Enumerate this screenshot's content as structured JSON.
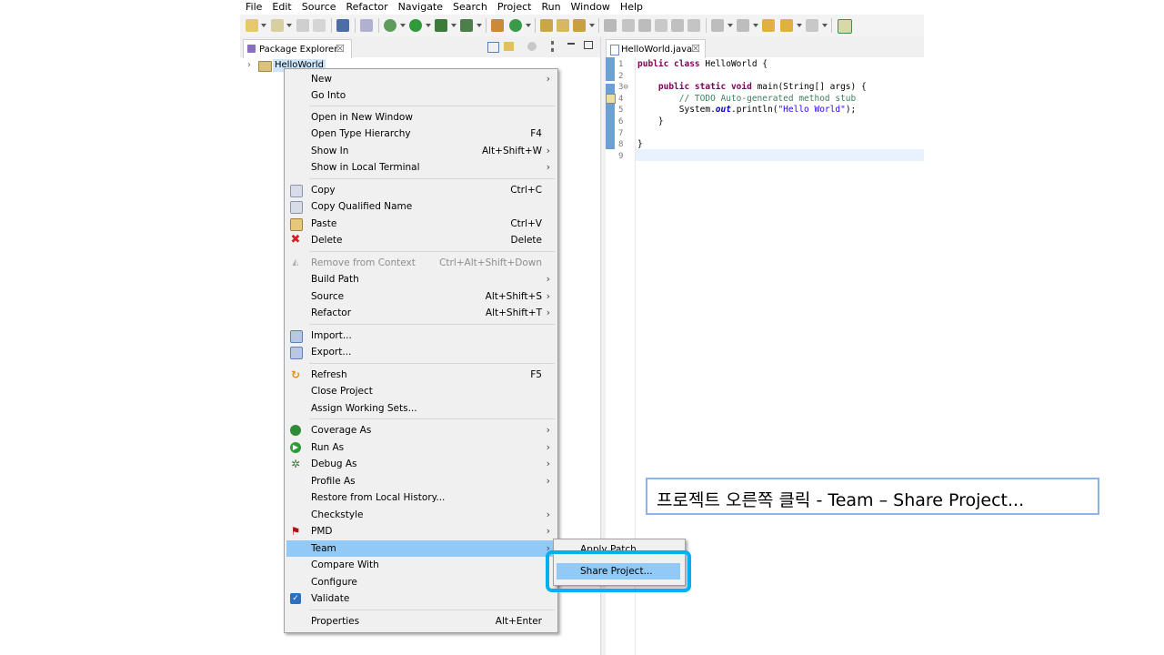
{
  "menubar": [
    "File",
    "Edit",
    "Source",
    "Refactor",
    "Navigate",
    "Search",
    "Project",
    "Run",
    "Window",
    "Help"
  ],
  "package_explorer": {
    "tab_label": "Package Explorer",
    "close_glyph": "☒",
    "project": "HelloWorld"
  },
  "editor": {
    "tab_label": "HelloWorld.java",
    "line_numbers": [
      "1",
      "2",
      "3⊖",
      "4",
      "5",
      "6",
      "7",
      "8",
      "9"
    ]
  },
  "context_menu": {
    "items": [
      {
        "label": "New",
        "shortcut": "",
        "arrow": "›"
      },
      {
        "label": "Go Into",
        "shortcut": "",
        "arrow": ""
      },
      {
        "label": "Open in New Window",
        "shortcut": "",
        "arrow": ""
      },
      {
        "label": "Open Type Hierarchy",
        "shortcut": "F4",
        "arrow": ""
      },
      {
        "label": "Show In",
        "shortcut": "Alt+Shift+W",
        "arrow": "›"
      },
      {
        "label": "Show in Local Terminal",
        "shortcut": "",
        "arrow": "›"
      },
      {
        "label": "Copy",
        "shortcut": "Ctrl+C",
        "arrow": ""
      },
      {
        "label": "Copy Qualified Name",
        "shortcut": "",
        "arrow": ""
      },
      {
        "label": "Paste",
        "shortcut": "Ctrl+V",
        "arrow": ""
      },
      {
        "label": "Delete",
        "shortcut": "Delete",
        "arrow": ""
      },
      {
        "label": "Remove from Context",
        "shortcut": "Ctrl+Alt+Shift+Down",
        "arrow": ""
      },
      {
        "label": "Build Path",
        "shortcut": "",
        "arrow": "›"
      },
      {
        "label": "Source",
        "shortcut": "Alt+Shift+S",
        "arrow": "›"
      },
      {
        "label": "Refactor",
        "shortcut": "Alt+Shift+T",
        "arrow": "›"
      },
      {
        "label": "Import...",
        "shortcut": "",
        "arrow": ""
      },
      {
        "label": "Export...",
        "shortcut": "",
        "arrow": ""
      },
      {
        "label": "Refresh",
        "shortcut": "F5",
        "arrow": ""
      },
      {
        "label": "Close Project",
        "shortcut": "",
        "arrow": ""
      },
      {
        "label": "Assign Working Sets...",
        "shortcut": "",
        "arrow": ""
      },
      {
        "label": "Coverage As",
        "shortcut": "",
        "arrow": "›"
      },
      {
        "label": "Run As",
        "shortcut": "",
        "arrow": "›"
      },
      {
        "label": "Debug As",
        "shortcut": "",
        "arrow": "›"
      },
      {
        "label": "Profile As",
        "shortcut": "",
        "arrow": "›"
      },
      {
        "label": "Restore from Local History...",
        "shortcut": "",
        "arrow": ""
      },
      {
        "label": "Checkstyle",
        "shortcut": "",
        "arrow": "›"
      },
      {
        "label": "PMD",
        "shortcut": "",
        "arrow": "›"
      },
      {
        "label": "Team",
        "shortcut": "",
        "arrow": "›"
      },
      {
        "label": "Compare With",
        "shortcut": "",
        "arrow": "›"
      },
      {
        "label": "Configure",
        "shortcut": "",
        "arrow": "›"
      },
      {
        "label": "Validate",
        "shortcut": "",
        "arrow": ""
      },
      {
        "label": "Properties",
        "shortcut": "Alt+Enter",
        "arrow": ""
      }
    ],
    "selected_item": "Team",
    "disabled_item": "Remove from Context"
  },
  "team_submenu": {
    "items": [
      "Apply Patch...",
      "Share Project..."
    ],
    "selected_item": "Share Project..."
  },
  "callout": {
    "text": "프로젝트 오른쪽 클릭 - Team – Share Project..."
  },
  "colors": {
    "selection": "#91c9f7",
    "highlight_box": "#00b0f0",
    "callout_border": "#8eb4e3",
    "keyword": "#7f0055",
    "comment": "#3f7f5f",
    "string": "#2a00ff"
  },
  "icons": [
    "copy-icon",
    "copy-qualified-icon",
    "paste-icon",
    "delete-icon",
    "remove-context-icon",
    "import-icon",
    "export-icon",
    "refresh-icon",
    "coverage-icon",
    "run-icon",
    "debug-icon",
    "pmd-icon",
    "validate-check-icon"
  ]
}
